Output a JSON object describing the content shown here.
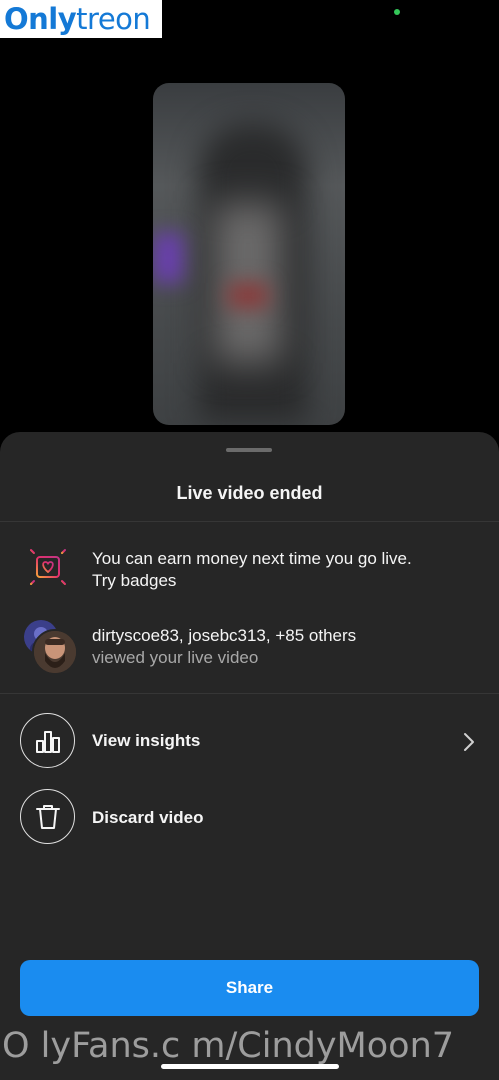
{
  "watermark": {
    "logo_part1": "Only",
    "logo_part2": "treon",
    "url": "O lyFans.c m/CindyMoon7"
  },
  "sheet": {
    "title": "Live video ended",
    "badge_promo": {
      "line1": "You can earn money next time you go live.",
      "line2": "Try badges"
    },
    "viewers": {
      "names": "dirtyscoe83, josebc313, +85 others",
      "caption": "viewed your live video"
    },
    "actions": [
      {
        "label": "View insights",
        "icon": "bar-chart-icon"
      },
      {
        "label": "Discard video",
        "icon": "trash-icon"
      }
    ],
    "share_label": "Share"
  },
  "colors": {
    "sheet_bg": "#262626",
    "accent": "#1a8cf0",
    "secondary_text": "#a8a8a8"
  }
}
